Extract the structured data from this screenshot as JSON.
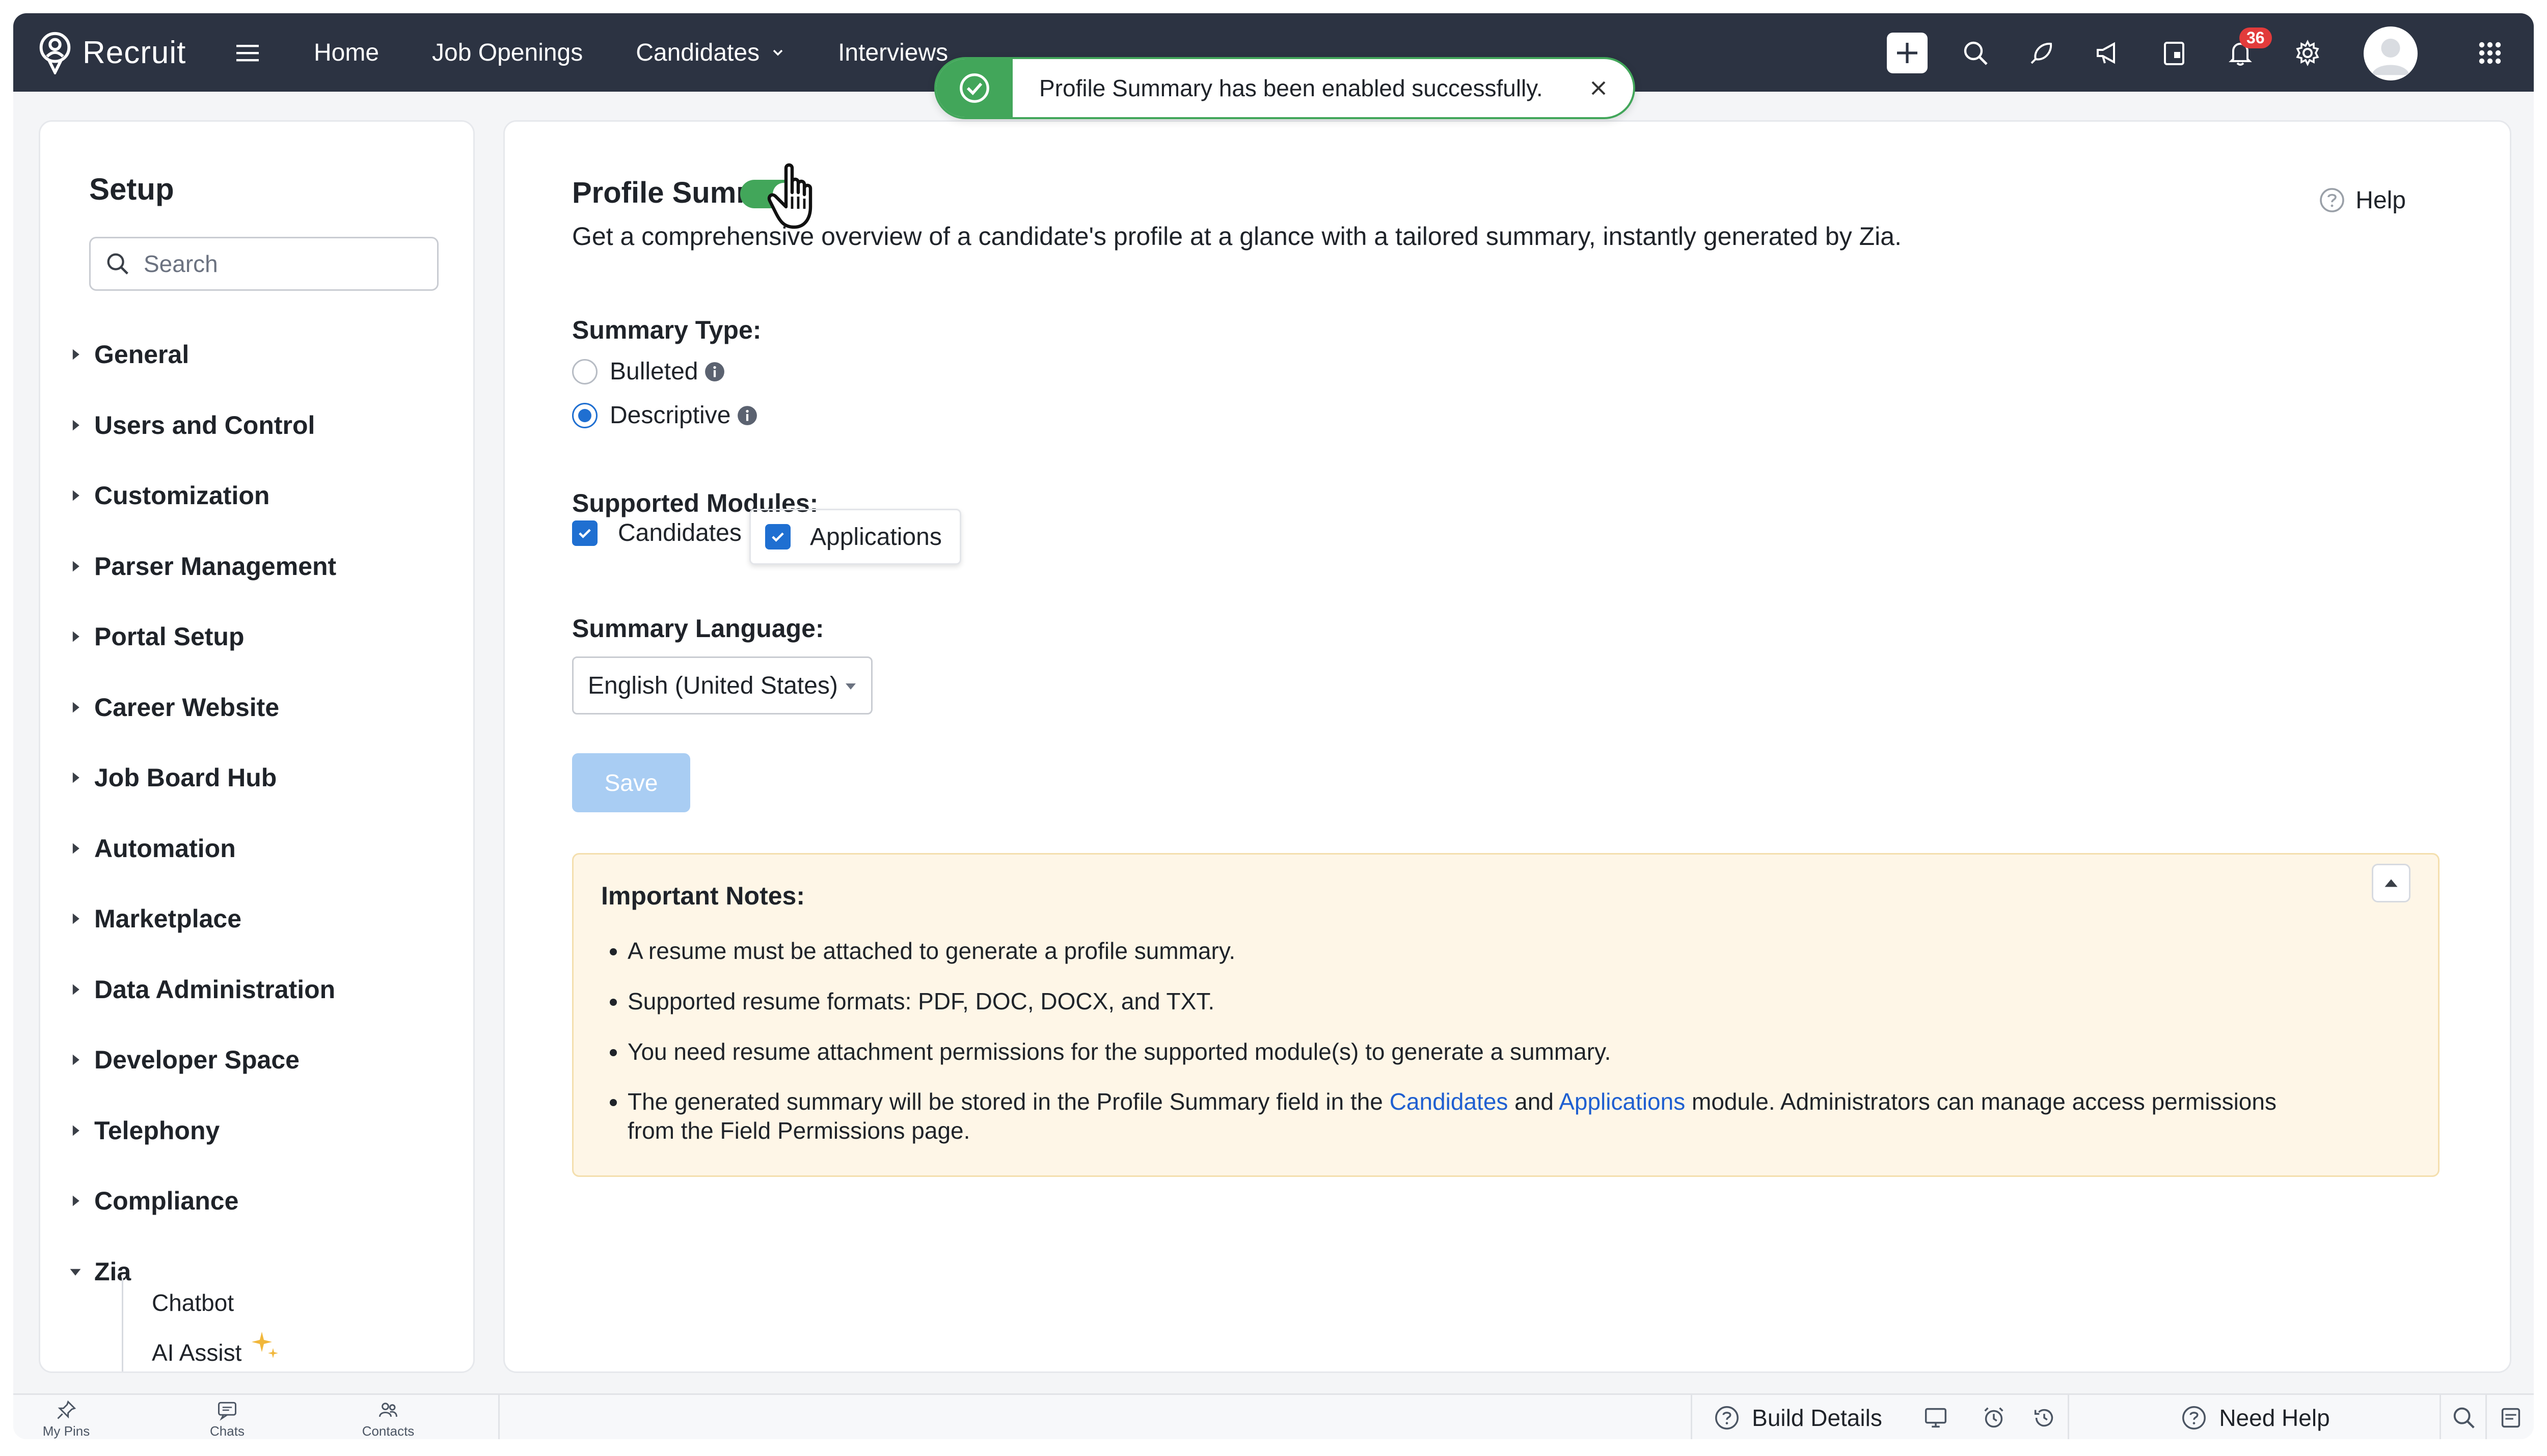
{
  "app": {
    "name": "Recruit"
  },
  "nav": {
    "items": [
      {
        "label": "Home",
        "has_dropdown": false
      },
      {
        "label": "Job Openings",
        "has_dropdown": false
      },
      {
        "label": "Candidates",
        "has_dropdown": true
      },
      {
        "label": "Interviews",
        "has_dropdown": false
      }
    ],
    "notification_count": "36"
  },
  "toast": {
    "message": "Profile Summary has been enabled successfully.",
    "color": "#42a65a"
  },
  "sidebar": {
    "title": "Setup",
    "search_placeholder": "Search",
    "items": [
      "General",
      "Users and Control",
      "Customization",
      "Parser Management",
      "Portal Setup",
      "Career Website",
      "Job Board Hub",
      "Automation",
      "Marketplace",
      "Data Administration",
      "Developer Space",
      "Telephony",
      "Compliance",
      "Zia"
    ],
    "expanded": "Zia",
    "sub_items": [
      "Chatbot",
      "AI Assist"
    ]
  },
  "main": {
    "title": "Profile Summary",
    "toggle_on": true,
    "help_label": "Help",
    "description": "Get a comprehensive overview of a candidate's profile at a glance with a tailored summary, instantly generated by Zia.",
    "summary_type_label": "Summary Type:",
    "summary_types": [
      {
        "label": "Bulleted",
        "selected": false
      },
      {
        "label": "Descriptive",
        "selected": true
      }
    ],
    "modules_label": "Supported Modules:",
    "modules": [
      {
        "label": "Candidates",
        "checked": true
      },
      {
        "label": "Applications",
        "checked": true
      }
    ],
    "language_label": "Summary Language:",
    "language_value": "English (United States)",
    "save_label": "Save",
    "notes": {
      "title": "Important Notes:",
      "items": [
        "A resume must be attached to generate a profile summary.",
        "Supported resume formats: PDF, DOC, DOCX, and TXT.",
        "You need resume attachment permissions for the supported module(s) to generate a summary."
      ],
      "last_item": {
        "before": "The generated summary will be stored in the Profile Summary field in the ",
        "link1": "Candidates",
        "middle": " and ",
        "link2": "Applications",
        "after": " module. Administrators can manage access permissions from the Field Permissions page."
      }
    }
  },
  "bottom_bar": {
    "tabs": [
      "My Pins",
      "Chats",
      "Contacts"
    ],
    "build_details": "Build Details",
    "need_help": "Need Help"
  },
  "colors": {
    "topbar": "#2c3342",
    "accent": "#1f6fd1",
    "success": "#42a65a",
    "notes_bg": "#fef6e7"
  }
}
